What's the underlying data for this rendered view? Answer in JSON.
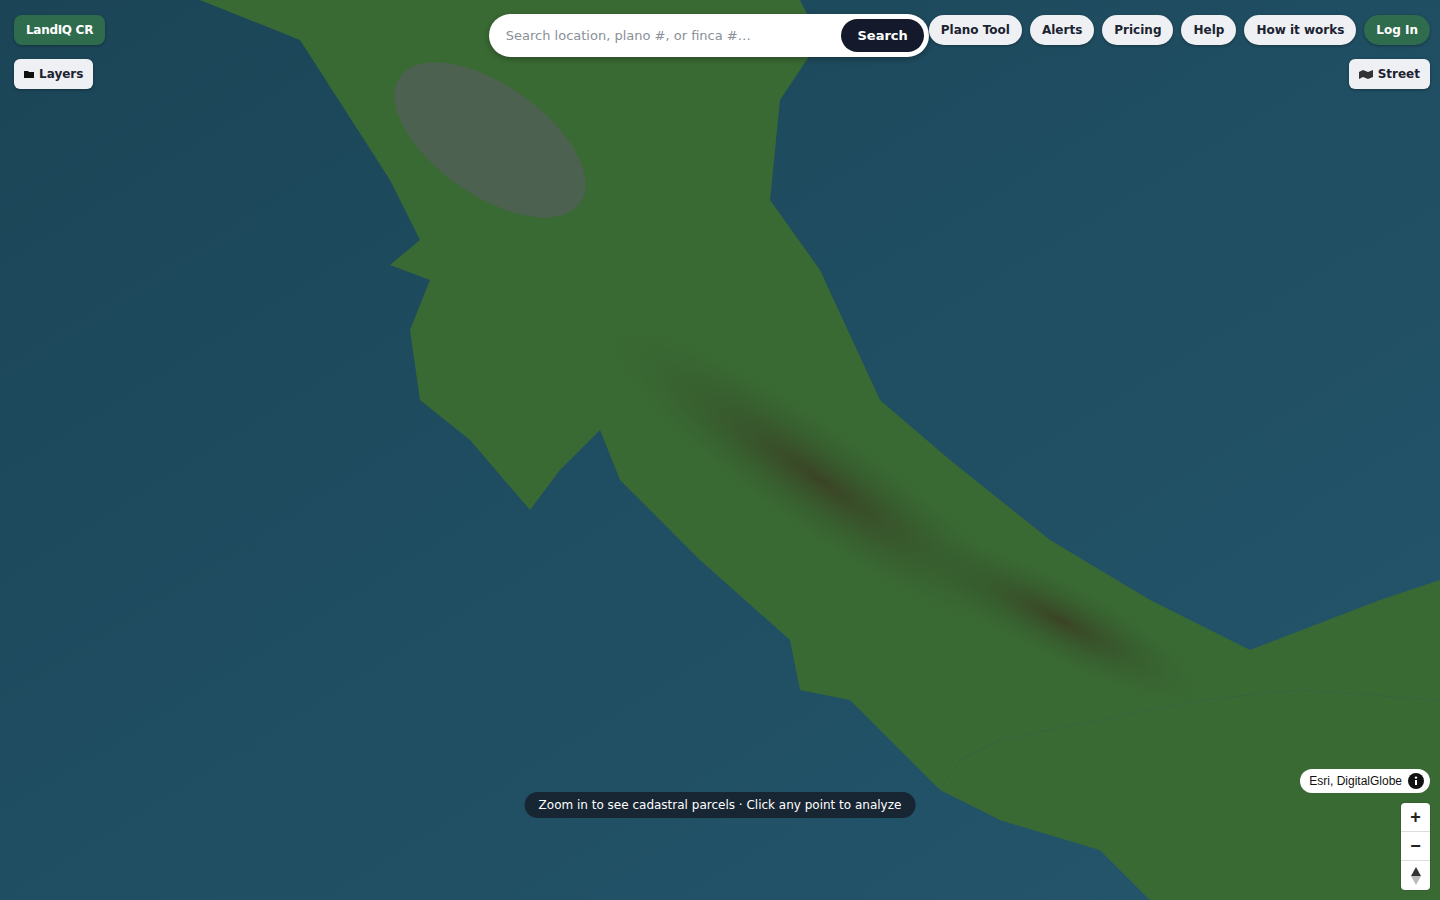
{
  "brand": "LandIQ CR",
  "layers_button": {
    "label": "Layers"
  },
  "search": {
    "placeholder": "Search location, plano #, or finca #…",
    "button": "Search"
  },
  "nav": [
    {
      "label": "Plano Tool"
    },
    {
      "label": "Alerts"
    },
    {
      "label": "Pricing"
    },
    {
      "label": "Help"
    },
    {
      "label": "How it works"
    }
  ],
  "login": "Log In",
  "basemap_toggle": {
    "label": "Street"
  },
  "hint": "Zoom in to see cadastral parcels · Click any point to analyze",
  "attribution": "Esri, DigitalGlobe",
  "zoom": {
    "in": "+",
    "out": "−"
  }
}
